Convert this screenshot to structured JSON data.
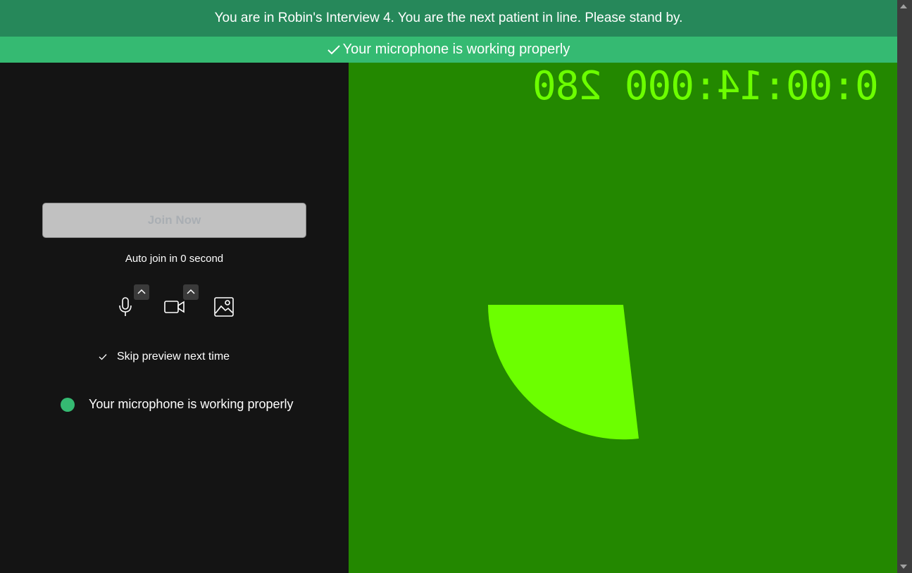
{
  "banner": {
    "text": "You are in Robin's Interview 4. You are the next patient in line. Please stand by."
  },
  "mic_banner": {
    "icon": "check-icon",
    "text": "Your microphone is working properly"
  },
  "preview": {
    "join_label": "Join Now",
    "auto_join_text": "Auto join in 0 second",
    "controls": {
      "microphone_icon": "microphone-icon",
      "camera_icon": "camera-icon",
      "background_icon": "image-icon",
      "options_icon": "chevron-up-icon"
    },
    "skip_preview_label": "Skip preview next time",
    "mic_status_text": "Your microphone is working properly"
  },
  "video": {
    "timer_text": "0:00:14:000 280"
  },
  "colors": {
    "banner_bg": "#26885a",
    "mic_banner_bg": "#35ba72",
    "panel_bg": "#141414",
    "video_bg": "#238800",
    "video_accent": "#6cff00",
    "status_dot": "#35ba72"
  }
}
